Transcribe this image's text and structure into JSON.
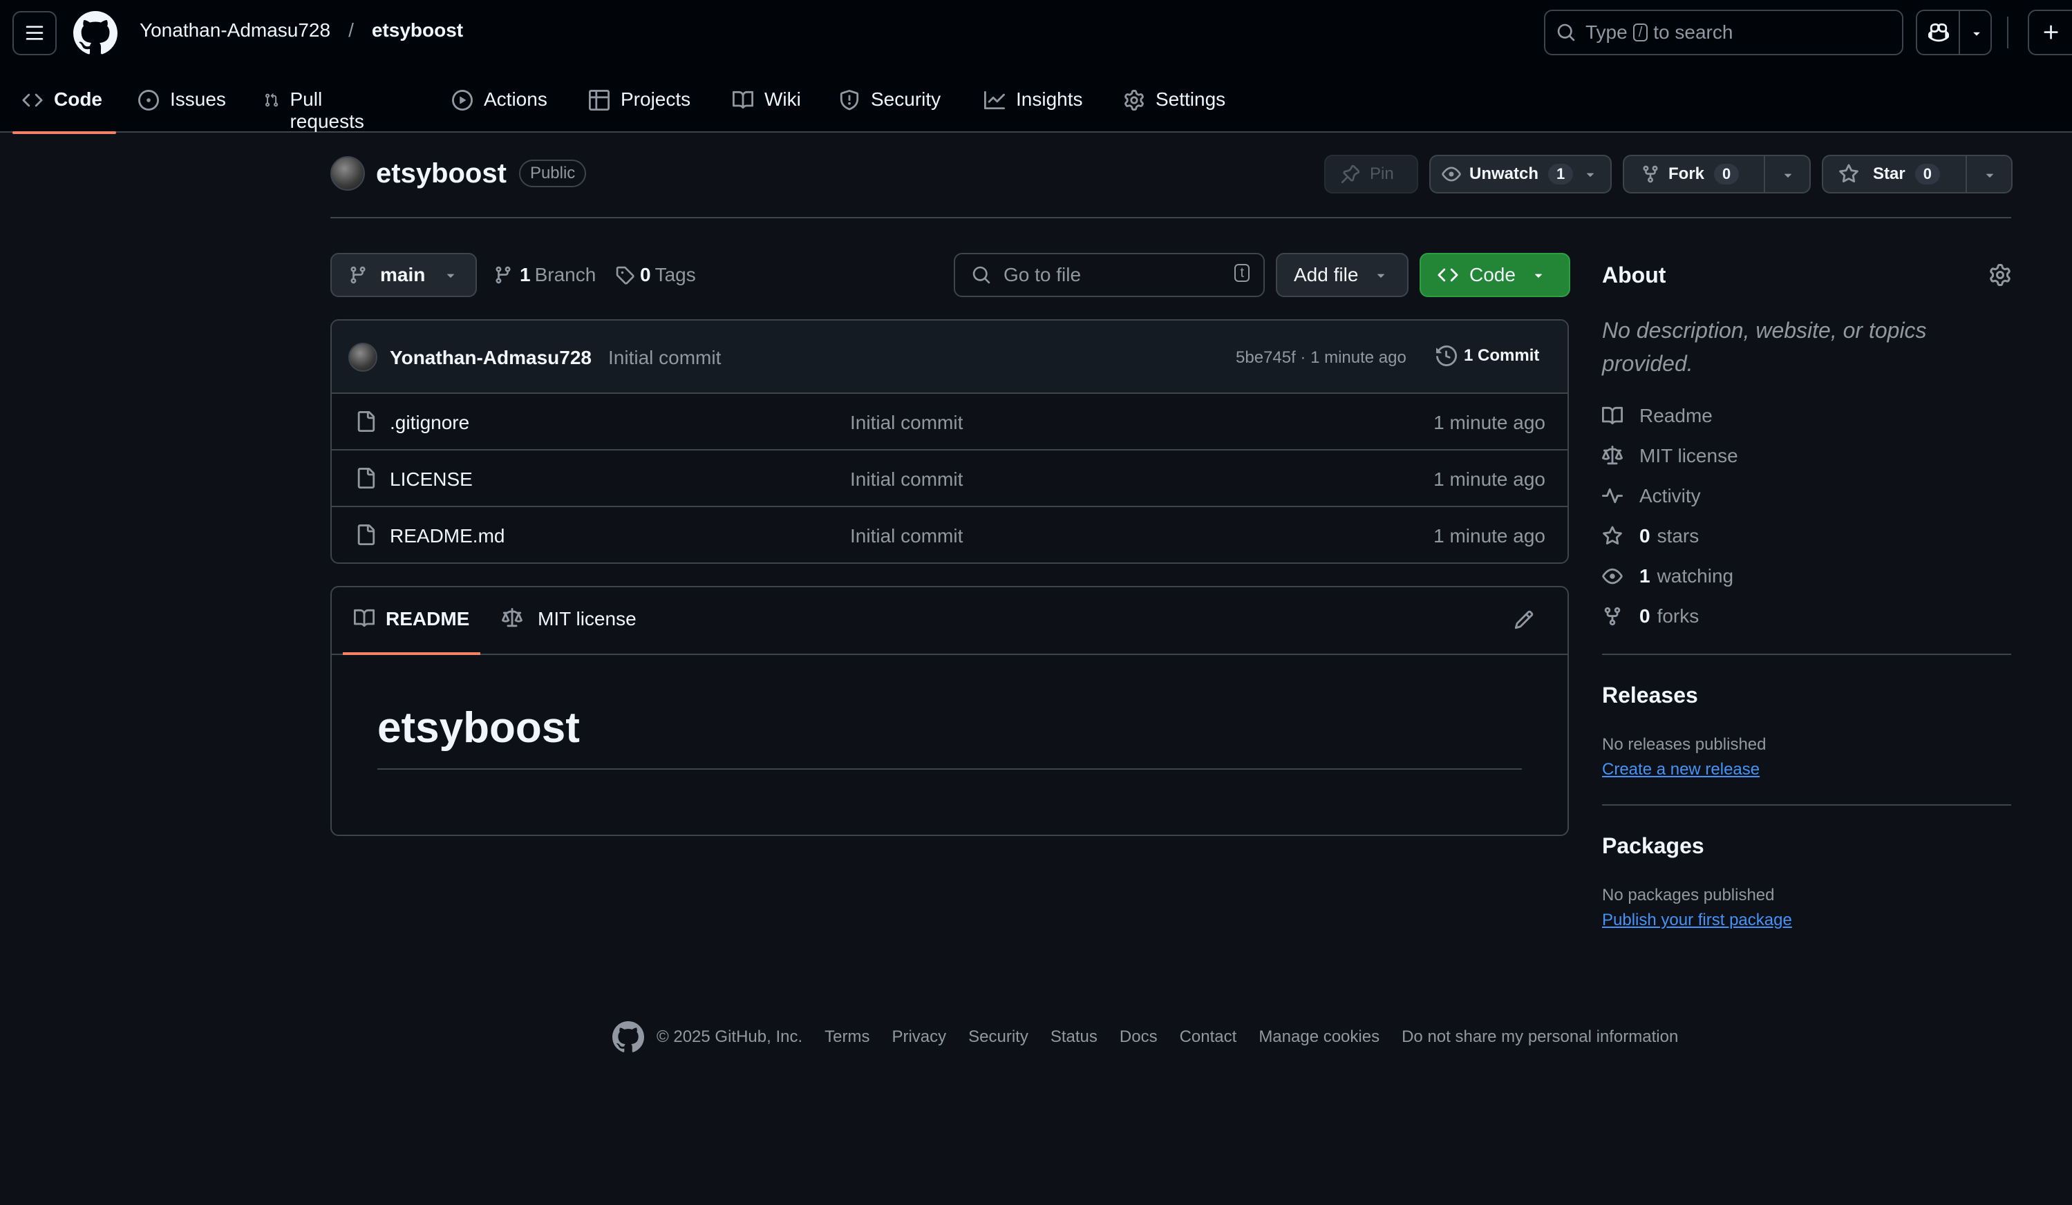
{
  "header": {
    "owner": "Yonathan-Admasu728",
    "separator": "/",
    "repo": "etsyboost",
    "search_prefix": "Type",
    "search_key": "/",
    "search_suffix": "to search"
  },
  "nav": [
    {
      "label": "Code",
      "icon": "code-icon",
      "active": true
    },
    {
      "label": "Issues",
      "icon": "issue-icon"
    },
    {
      "label": "Pull requests",
      "icon": "pull-request-icon"
    },
    {
      "label": "Actions",
      "icon": "play-icon"
    },
    {
      "label": "Projects",
      "icon": "table-icon"
    },
    {
      "label": "Wiki",
      "icon": "book-icon"
    },
    {
      "label": "Security",
      "icon": "shield-icon"
    },
    {
      "label": "Insights",
      "icon": "graph-icon"
    },
    {
      "label": "Settings",
      "icon": "gear-icon"
    }
  ],
  "repo": {
    "name": "etsyboost",
    "visibility": "Public",
    "pin_label": "Pin",
    "unwatch_label": "Unwatch",
    "watch_count": "1",
    "fork_label": "Fork",
    "fork_count": "0",
    "star_label": "Star",
    "star_count": "0"
  },
  "controls": {
    "branch": "main",
    "branch_count": "1",
    "branch_label": "Branch",
    "tag_count": "0",
    "tag_label": "Tags",
    "goto_placeholder": "Go to file",
    "goto_key": "t",
    "add_file": "Add file",
    "code": "Code"
  },
  "commit": {
    "author": "Yonathan-Admasu728",
    "message": "Initial commit",
    "sha_time": "5be745f · 1 minute ago",
    "commit_count": "1 Commit"
  },
  "files": [
    {
      "name": ".gitignore",
      "message": "Initial commit",
      "time": "1 minute ago"
    },
    {
      "name": "LICENSE",
      "message": "Initial commit",
      "time": "1 minute ago"
    },
    {
      "name": "README.md",
      "message": "Initial commit",
      "time": "1 minute ago"
    }
  ],
  "readme": {
    "tab_readme": "README",
    "tab_license": "MIT license",
    "heading": "etsyboost"
  },
  "about": {
    "title": "About",
    "description": "No description, website, or topics provided.",
    "readme": "Readme",
    "license": "MIT license",
    "activity": "Activity",
    "stars_count": "0",
    "stars_label": "stars",
    "watching_count": "1",
    "watching_label": "watching",
    "forks_count": "0",
    "forks_label": "forks"
  },
  "releases": {
    "title": "Releases",
    "empty": "No releases published",
    "link": "Create a new release"
  },
  "packages": {
    "title": "Packages",
    "empty": "No packages published",
    "link": "Publish your first package"
  },
  "footer": {
    "copyright": "© 2025 GitHub, Inc.",
    "links": [
      "Terms",
      "Privacy",
      "Security",
      "Status",
      "Docs",
      "Contact",
      "Manage cookies",
      "Do not share my personal information"
    ]
  },
  "colors": {
    "accent_underline": "#f78166",
    "code_button": "#238636",
    "link": "#4493f8"
  }
}
